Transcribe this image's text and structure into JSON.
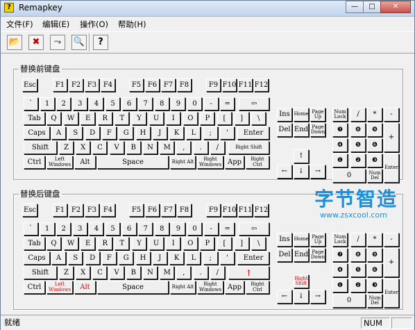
{
  "window": {
    "title": "Remapkey",
    "app_icon_glyph": "?"
  },
  "controls": {
    "minimize": "—",
    "maximize": "□",
    "close": "✕"
  },
  "menu": [
    "文件(F)",
    "编辑(E)",
    "操作(O)",
    "帮助(H)"
  ],
  "toolbar": [
    {
      "name": "open-icon",
      "glyph": "📂"
    },
    {
      "name": "delete-icon",
      "glyph": "✖"
    },
    {
      "name": "remap-icon",
      "glyph": "⤳"
    },
    {
      "name": "preview-icon",
      "glyph": "🔍"
    },
    {
      "name": "help-icon",
      "glyph": "?"
    }
  ],
  "groups": {
    "before": "替换前键盘",
    "after": "替换后键盘"
  },
  "keys": {
    "esc": "Esc",
    "f1": "F1",
    "f2": "F2",
    "f3": "F3",
    "f4": "F4",
    "f5": "F5",
    "f6": "F6",
    "f7": "F7",
    "f8": "F8",
    "f9": "F9",
    "f10": "F10",
    "f11": "F11",
    "f12": "F12",
    "grave": "`",
    "n1": "1",
    "n2": "2",
    "n3": "3",
    "n4": "4",
    "n5": "5",
    "n6": "6",
    "n7": "7",
    "n8": "8",
    "n9": "9",
    "n0": "0",
    "minus": "-",
    "equal": "=",
    "backspace": "⇦",
    "tab": "Tab",
    "q": "Q",
    "w": "W",
    "e": "E",
    "r": "R",
    "t": "T",
    "y": "Y",
    "u": "U",
    "i": "I",
    "o": "O",
    "p": "P",
    "lbracket": "[",
    "rbracket": "]",
    "backslash": "\\",
    "caps": "Caps",
    "a": "A",
    "s": "S",
    "d": "D",
    "f": "F",
    "g": "G",
    "h": "H",
    "j": "J",
    "k": "K",
    "l": "L",
    "semicolon": ";",
    "quote": "'",
    "enter": "Enter",
    "shift": "Shift",
    "z": "Z",
    "x": "X",
    "c": "C",
    "v": "V",
    "b": "B",
    "n": "N",
    "m": "M",
    "comma": ",",
    "period": ".",
    "slash": "/",
    "rshift": "Right Shift",
    "ctrl": "Ctrl",
    "lwin": "Left Windows",
    "alt": "Alt",
    "space": "Space",
    "ralt": "Right Alt",
    "rwin": "Right Windows",
    "app": "App",
    "rctrl": "Right Ctrl",
    "ins": "Ins",
    "home": "Home",
    "pgup": "Page Up",
    "del": "Del",
    "end": "End",
    "pgdn": "Page Down",
    "up": "↑",
    "left": "←",
    "down": "↓",
    "right": "→",
    "numlock": "Num Lock",
    "ndiv": "/",
    "nmul": "*",
    "nminus": "-",
    "np7": "❼",
    "np8": "❽",
    "np9": "❾",
    "nplus": "+",
    "np4": "❹",
    "np5": "❺",
    "np6": "❻",
    "np1": "❶",
    "np2": "❷",
    "np3": "❸",
    "nenter": "Enter",
    "np0": "0",
    "npdel": "Num Del"
  },
  "remapped": {
    "rshift_arrow": "↑",
    "ralt_side": "Alt",
    "rlwin": "Left Windows",
    "rshift_nav": "Right Shift"
  },
  "watermark": {
    "title": "字节智造",
    "url": "www.zsxcool.com"
  },
  "status": {
    "text": "就绪",
    "num": "NUM"
  }
}
